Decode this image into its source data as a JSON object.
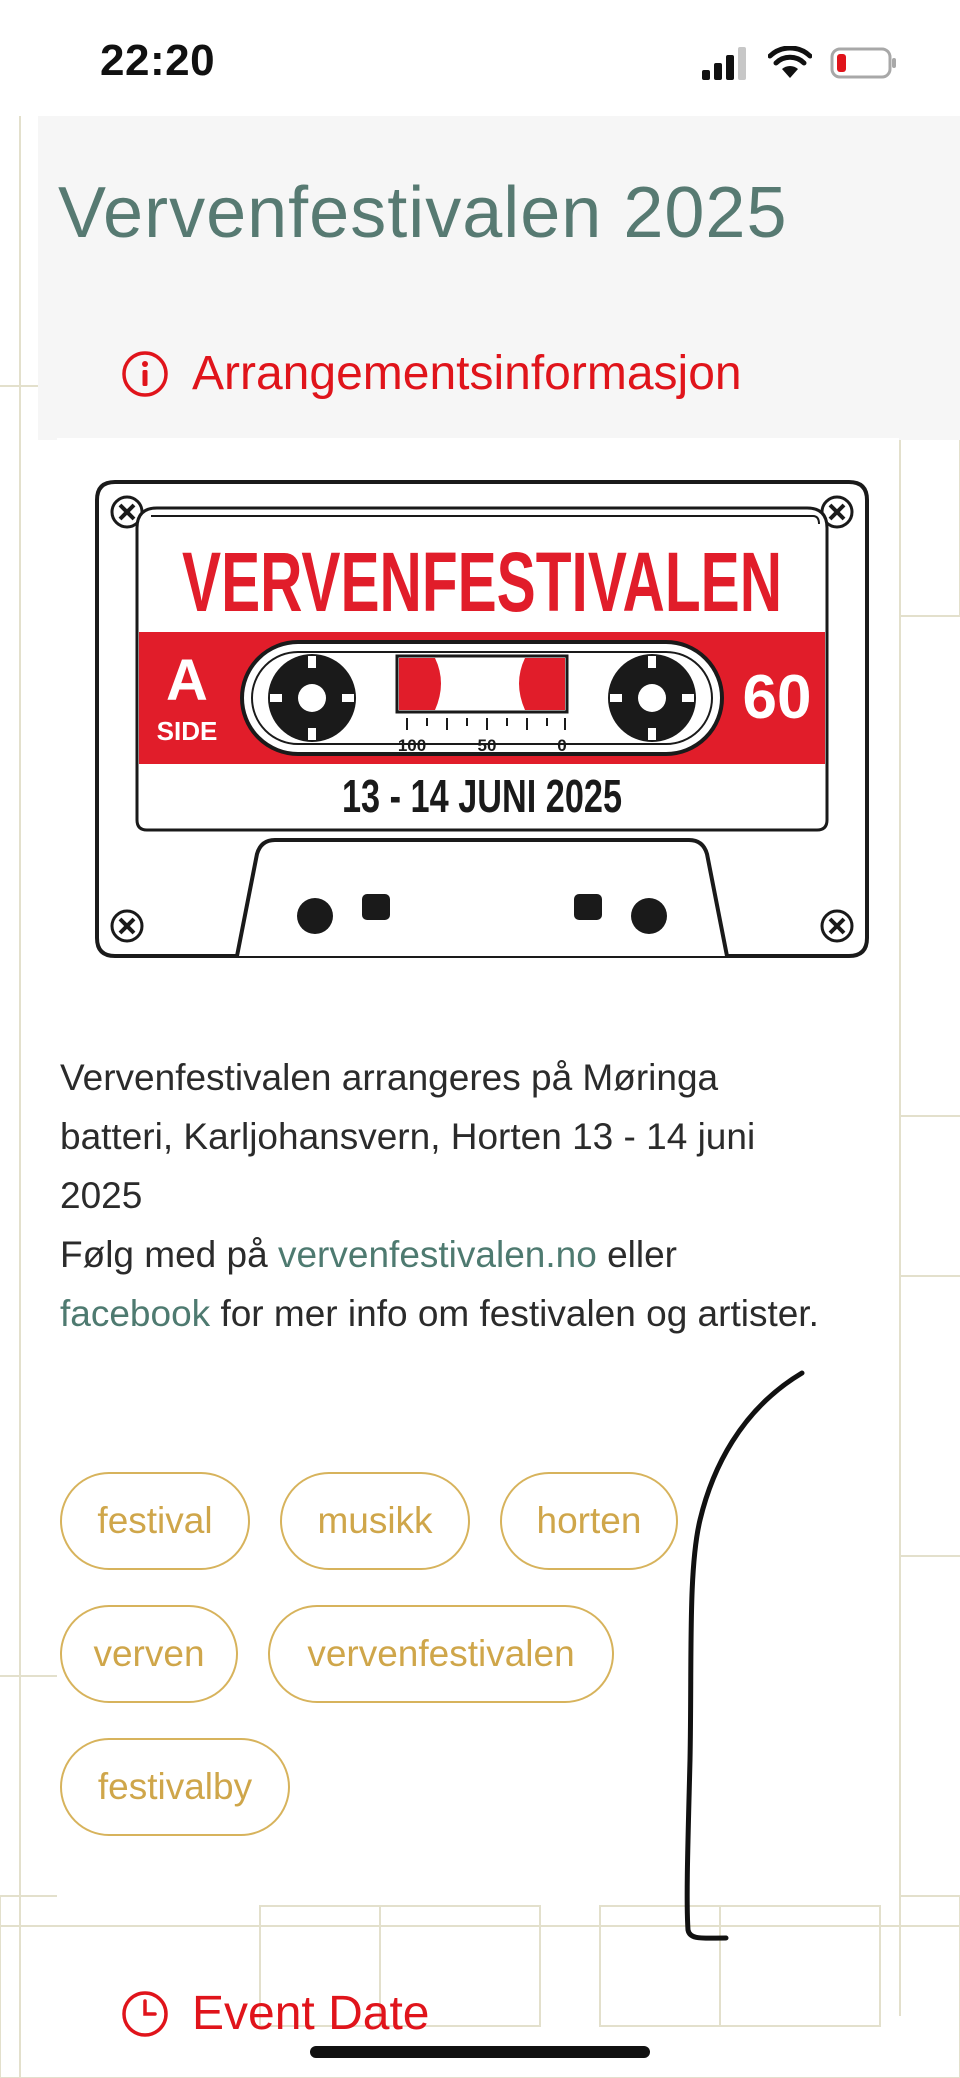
{
  "status_bar": {
    "time": "22:20",
    "icons": [
      "cellular-signal-icon",
      "wifi-icon",
      "battery-low-icon"
    ],
    "battery_color": "#e0141b"
  },
  "page": {
    "title": "Vervenfestivalen 2025"
  },
  "sections": {
    "info": {
      "icon": "info-icon",
      "label": "Arrangementsinformasjon"
    },
    "date": {
      "icon": "clock-icon",
      "label": "Event Date"
    }
  },
  "poster": {
    "headline": "VERVENFESTIVALEN",
    "side_letter": "A",
    "side_word": "SIDE",
    "tape_length": "60",
    "scale": [
      "100",
      "50",
      "0"
    ],
    "dates": "13 - 14 JUNI 2025",
    "colors": {
      "red": "#e11d2a",
      "black": "#1a1a1a"
    }
  },
  "description": {
    "line1": "Vervenfestivalen arrangeres på Møringa batteri, Karljohansvern, Horten 13 - 14 juni 2025",
    "line2_pre": "Følg med på ",
    "link1": "vervenfestivalen.no",
    "line2_mid": " eller ",
    "link2": "facebook",
    "line2_post": " for mer info om festivalen og artister."
  },
  "tags": [
    "festival",
    "musikk",
    "horten",
    "verven",
    "vervenfestivalen",
    "festivalby"
  ],
  "colors": {
    "title": "#577a72",
    "accent_red": "#e0141b",
    "link": "#4e7a70",
    "tag": "#d7b35c"
  }
}
